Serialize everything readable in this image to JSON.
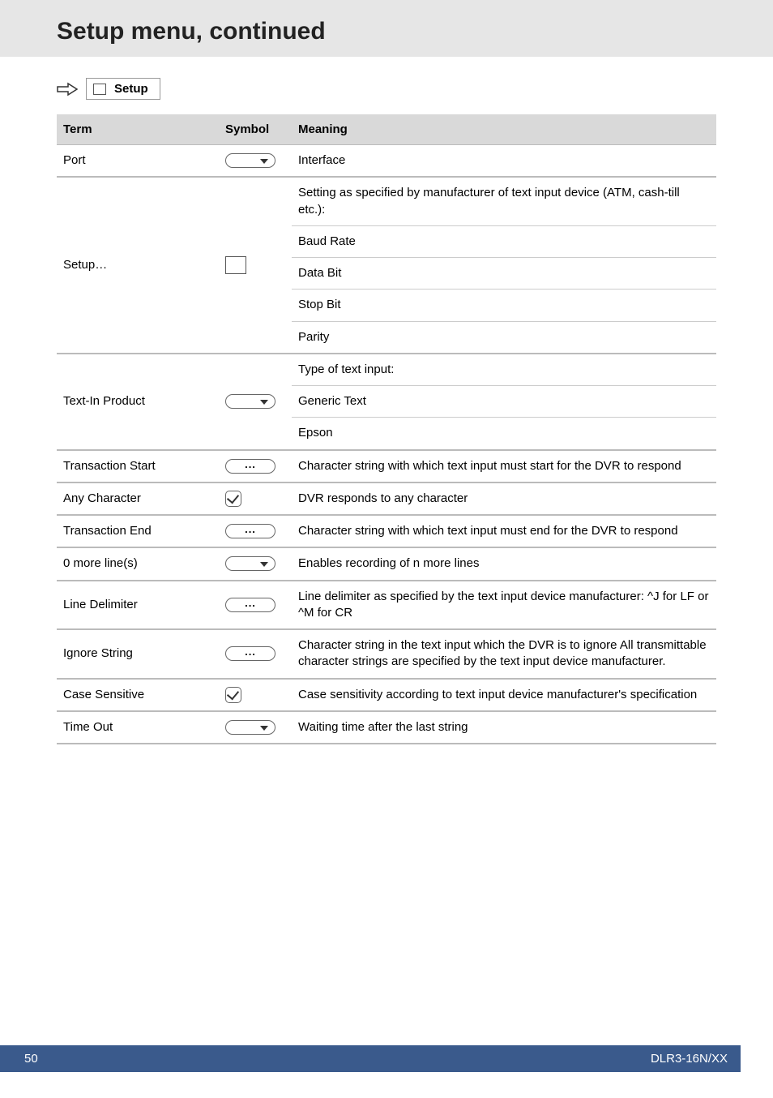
{
  "page_title": "Setup menu, continued",
  "breadcrumb_label": "Setup",
  "table": {
    "headers": {
      "term": "Term",
      "symbol": "Symbol",
      "meaning": "Meaning"
    },
    "rows": [
      {
        "term": "Port",
        "symbol": "dropdown",
        "meanings": [
          "Interface"
        ],
        "group_end": true
      },
      {
        "term": "Setup…",
        "symbol": "box",
        "meanings": [
          "Setting as specified by manufacturer of text input device (ATM, cash-till etc.):",
          "Baud Rate",
          "Data Bit",
          "Stop Bit",
          "Parity"
        ],
        "group_end": true
      },
      {
        "term": "Text-In Product",
        "symbol": "dropdown",
        "meanings": [
          "Type of text input:",
          "Generic Text",
          "Epson"
        ],
        "group_end": true
      },
      {
        "term": "Transaction Start",
        "symbol": "ellipsis",
        "meanings": [
          "Character string with which text input must start for the DVR to respond"
        ],
        "group_end": true
      },
      {
        "term": "Any Character",
        "symbol": "check",
        "meanings": [
          "DVR responds to any character"
        ],
        "group_end": true
      },
      {
        "term": "Transaction End",
        "symbol": "ellipsis",
        "meanings": [
          "Character string with which text input must end for the DVR to respond"
        ],
        "group_end": true
      },
      {
        "term": "0 more line(s)",
        "symbol": "dropdown",
        "meanings": [
          "Enables recording of n more lines"
        ],
        "group_end": true
      },
      {
        "term": "Line Delimiter",
        "symbol": "ellipsis",
        "meanings": [
          "Line delimiter as specified by the text input device manufacturer: ^J for LF or ^M for CR"
        ],
        "group_end": true
      },
      {
        "term": "Ignore String",
        "symbol": "ellipsis",
        "meanings": [
          "Character string in the text input which the DVR is to ignore All transmittable character strings are specified by the text input device manufacturer."
        ],
        "group_end": true
      },
      {
        "term": "Case Sensitive",
        "symbol": "check",
        "meanings": [
          "Case sensitivity according to text input device manufacturer's specification"
        ],
        "group_end": true
      },
      {
        "term": "Time Out",
        "symbol": "dropdown",
        "meanings": [
          "Waiting time after the last string"
        ],
        "group_end": true
      }
    ]
  },
  "footer": {
    "page": "50",
    "doc_id": "DLR3-16N/XX"
  }
}
